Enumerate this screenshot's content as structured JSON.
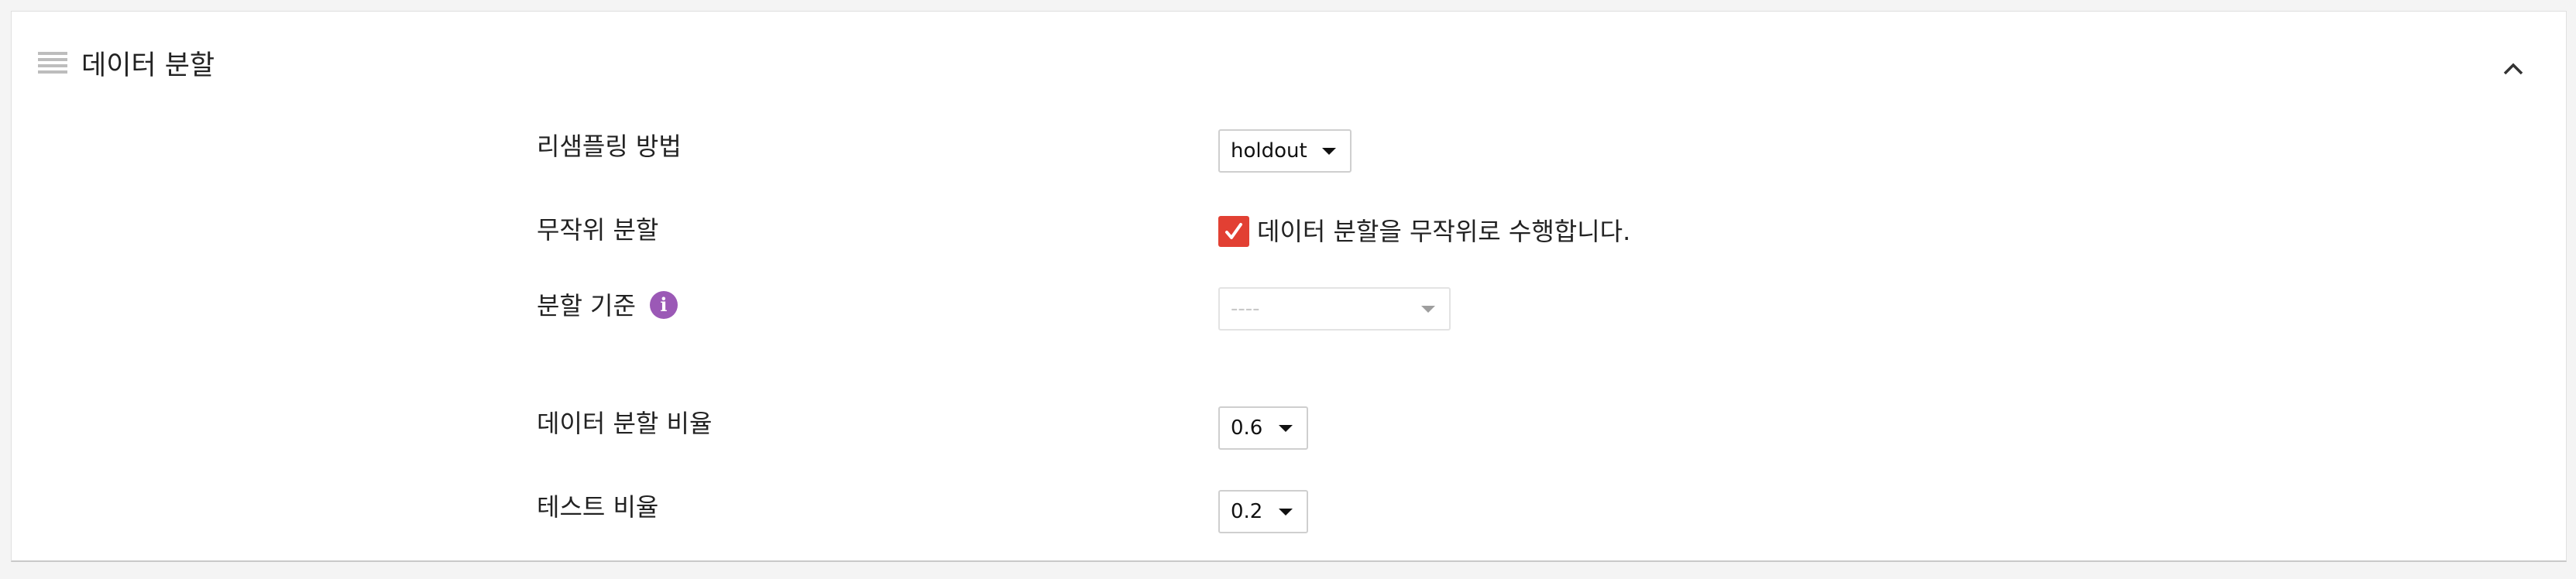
{
  "section": {
    "title": "데이터 분할",
    "drag_icon": "drag-handle-icon",
    "collapse_icon": "chevron-up-icon"
  },
  "fields": {
    "resampling": {
      "label": "리샘플링 방법",
      "value": "holdout"
    },
    "random_split": {
      "label": "무작위 분할",
      "checked": true,
      "checkbox_label": "데이터 분할을 무작위로 수행합니다."
    },
    "split_criteria": {
      "label": "분할 기준",
      "info_icon": "info-icon",
      "value": "----",
      "disabled": true
    },
    "split_ratio": {
      "label": "데이터 분할 비율",
      "value": "0.6"
    },
    "test_ratio": {
      "label": "테스트 비율",
      "value": "0.2"
    }
  },
  "colors": {
    "checkbox": "#e24033",
    "info_icon": "#9b59b6"
  }
}
